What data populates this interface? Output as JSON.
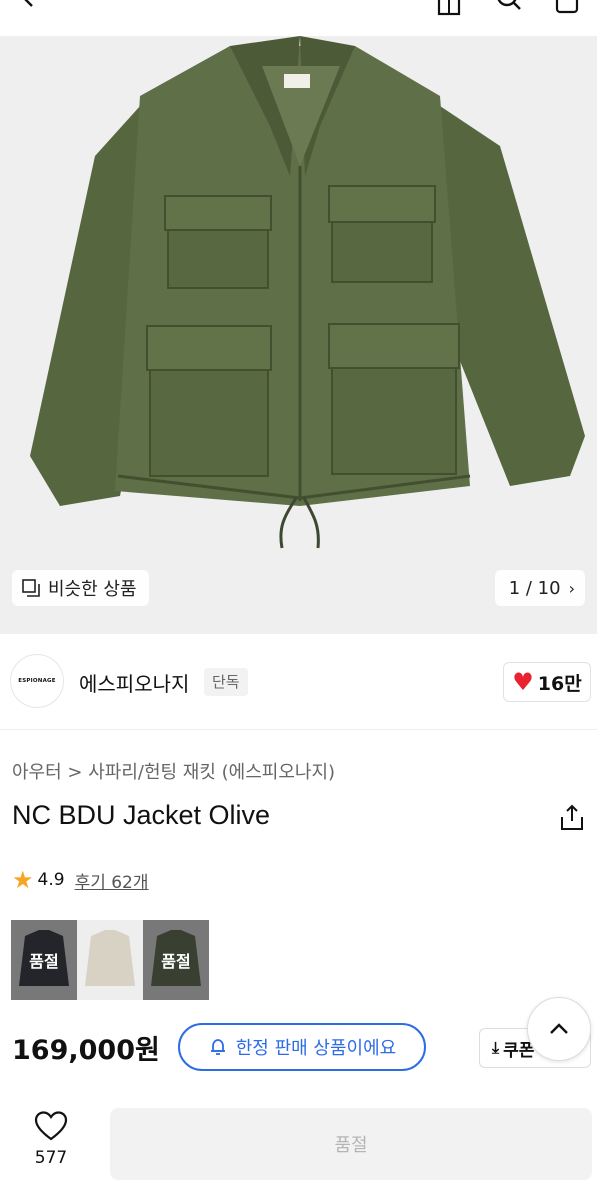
{
  "hero": {
    "similar_label": "비슷한 상품",
    "image_counter": "1 / 10"
  },
  "brand": {
    "name": "에스피오나지",
    "tag": "단독",
    "logo_text": "ESPIONAGE",
    "likes": "16만"
  },
  "product": {
    "breadcrumb": "아우터 > 사파리/헌팅 재킷 (에스피오나지)",
    "title": "NC BDU Jacket Olive",
    "rating": "4.9",
    "reviews": "후기 62개",
    "colors": [
      {
        "name": "navy",
        "sold_label": "품절"
      },
      {
        "name": "beige",
        "sold_label": ""
      },
      {
        "name": "olive",
        "sold_label": "품절"
      }
    ],
    "price": "169,000원"
  },
  "actions": {
    "limited_label": "한정 판매 상품이에요",
    "coupon_label": "쿠폰",
    "wish_count": "577",
    "buy_label": "품절"
  },
  "colors": {
    "accent_blue": "#2e6ce6",
    "heart_red": "#e8232f",
    "star": "#f5a623",
    "jacket_olive": "#5a6a45"
  }
}
